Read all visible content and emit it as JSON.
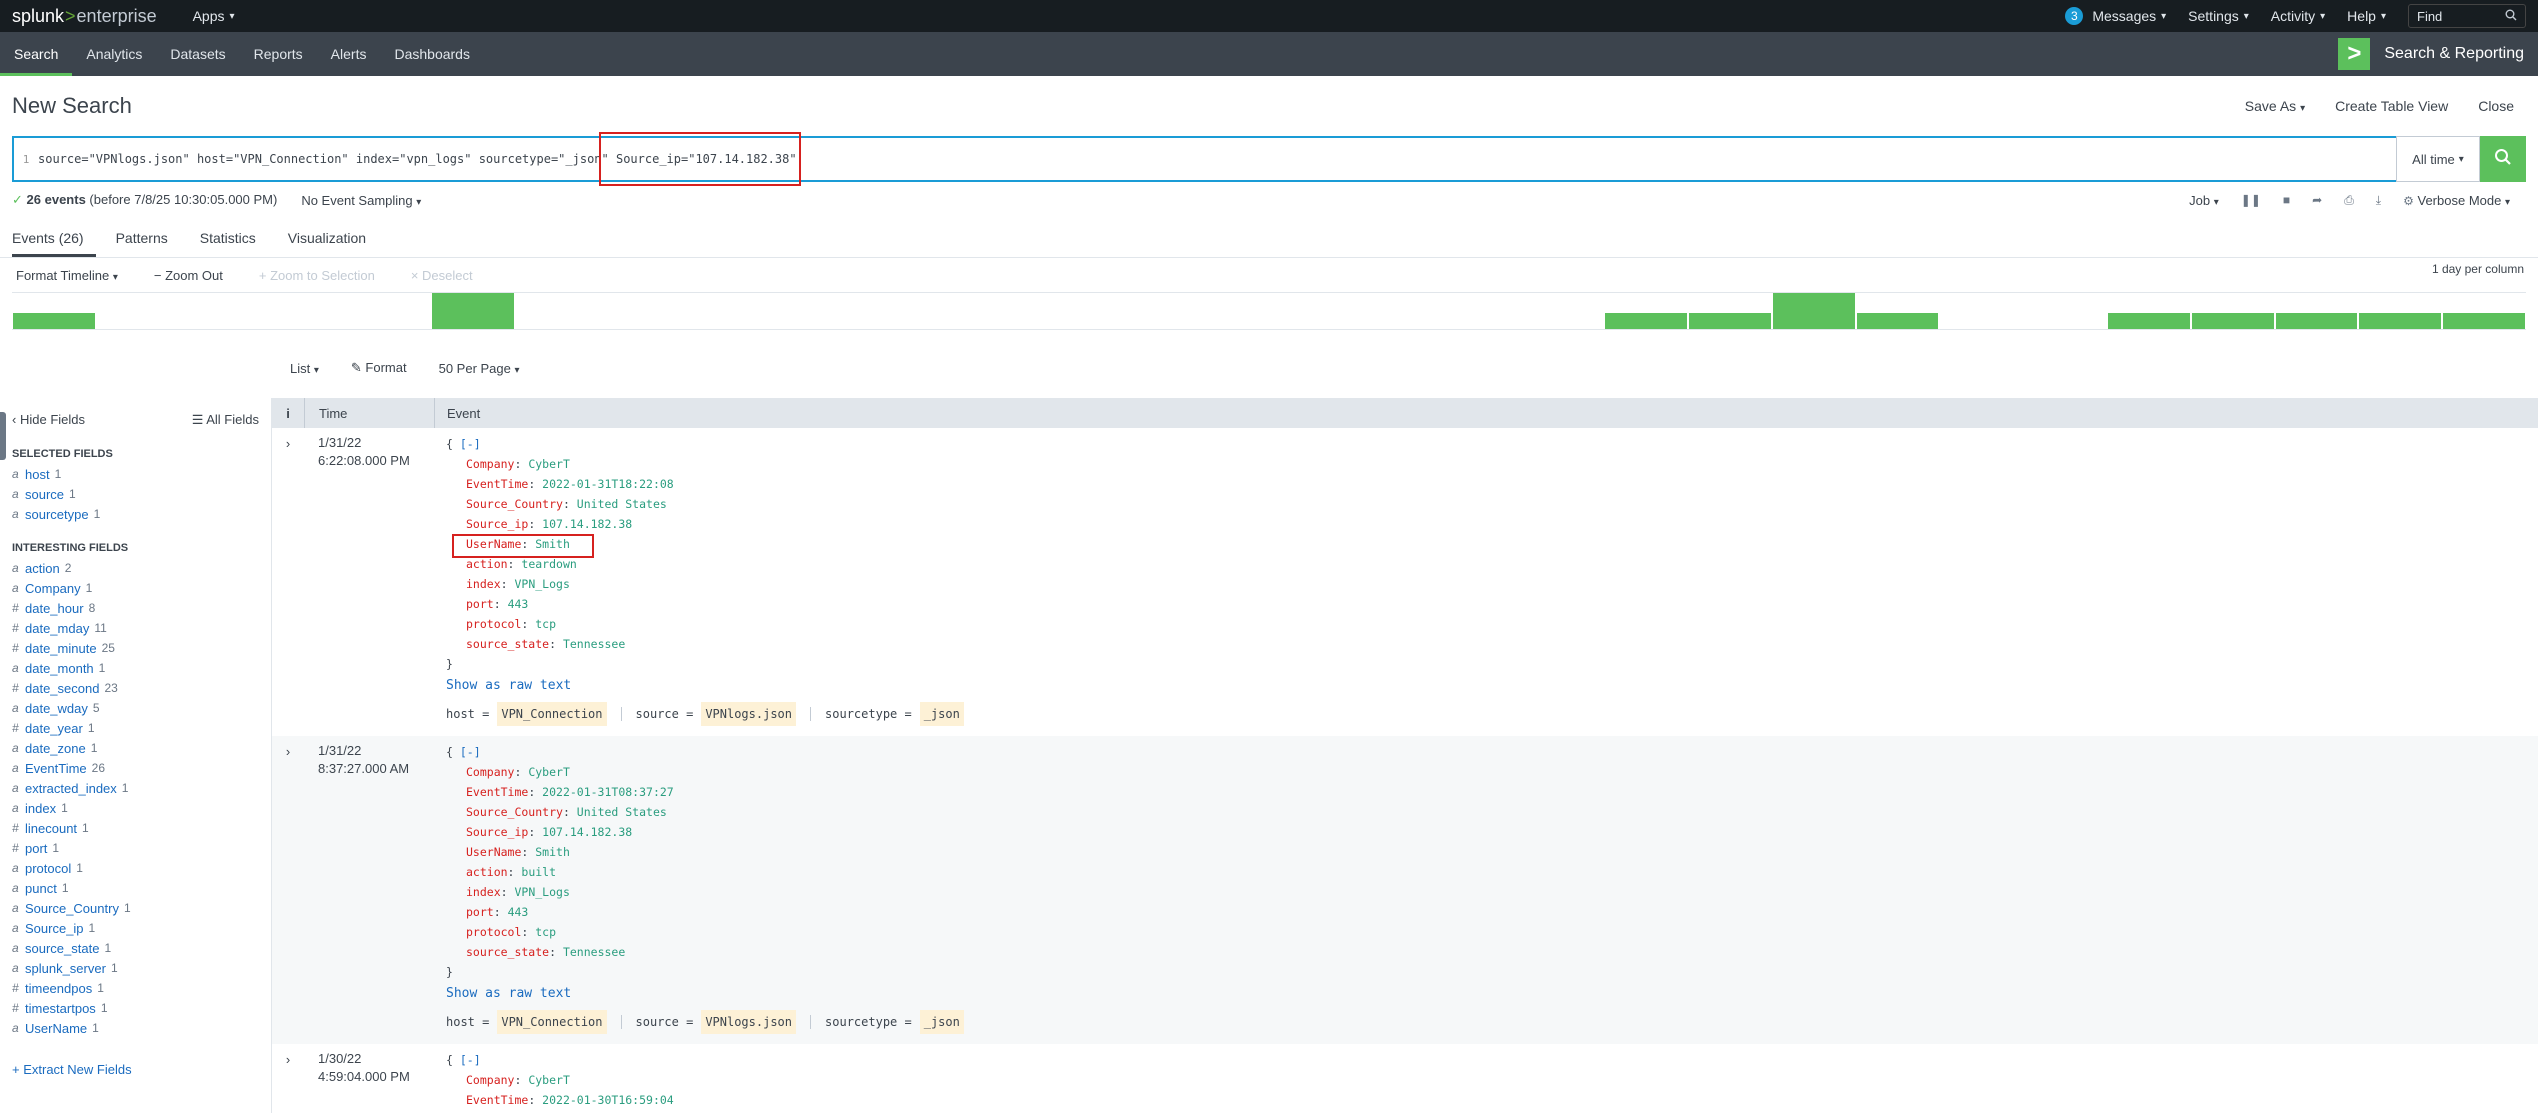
{
  "topbar": {
    "logo_main": "splunk",
    "logo_sep": ">",
    "logo_sub": "enterprise",
    "apps": "Apps",
    "messages_count": "3",
    "messages": "Messages",
    "settings": "Settings",
    "activity": "Activity",
    "help": "Help",
    "find": "Find"
  },
  "appbar": {
    "tabs": [
      "Search",
      "Analytics",
      "Datasets",
      "Reports",
      "Alerts",
      "Dashboards"
    ],
    "app_title": "Search & Reporting"
  },
  "page": {
    "title": "New Search",
    "save_as": "Save As",
    "create_table_view": "Create Table View",
    "close": "Close"
  },
  "search": {
    "line_number": "1",
    "query_part1": "source=\"VPNlogs.json\" host=\"VPN_Connection\" index=\"vpn_logs\" sourcetype=\"_json\" ",
    "query_part2": "Source_ip=\"107.14.182.38\"",
    "time_range": "All time"
  },
  "status": {
    "check": "✓",
    "events": "26 events",
    "before": "(before 7/8/25 10:30:05.000 PM)",
    "sampling": "No Event Sampling",
    "job": "Job",
    "mode": "Verbose Mode"
  },
  "result_tabs": [
    "Events (26)",
    "Patterns",
    "Statistics",
    "Visualization"
  ],
  "timeline": {
    "format": "Format Timeline",
    "zoom_out": "− Zoom Out",
    "zoom_selection": "+ Zoom to Selection",
    "deselect": "× Deselect",
    "per_column": "1 day per column",
    "bars": [
      0.45,
      1,
      0.45,
      0.45,
      1,
      0.45,
      0.45,
      0.45,
      0.45,
      0.45,
      0.45
    ]
  },
  "list_controls": {
    "list": "List",
    "format": "Format",
    "per_page": "50 Per Page"
  },
  "sidebar": {
    "hide_fields": "Hide Fields",
    "all_fields": "All Fields",
    "selected_title": "SELECTED FIELDS",
    "selected": [
      {
        "type": "a",
        "name": "host",
        "count": "1"
      },
      {
        "type": "a",
        "name": "source",
        "count": "1"
      },
      {
        "type": "a",
        "name": "sourcetype",
        "count": "1"
      }
    ],
    "interesting_title": "INTERESTING FIELDS",
    "interesting": [
      {
        "type": "a",
        "name": "action",
        "count": "2"
      },
      {
        "type": "a",
        "name": "Company",
        "count": "1"
      },
      {
        "type": "#",
        "name": "date_hour",
        "count": "8"
      },
      {
        "type": "#",
        "name": "date_mday",
        "count": "11"
      },
      {
        "type": "#",
        "name": "date_minute",
        "count": "25"
      },
      {
        "type": "a",
        "name": "date_month",
        "count": "1"
      },
      {
        "type": "#",
        "name": "date_second",
        "count": "23"
      },
      {
        "type": "a",
        "name": "date_wday",
        "count": "5"
      },
      {
        "type": "#",
        "name": "date_year",
        "count": "1"
      },
      {
        "type": "a",
        "name": "date_zone",
        "count": "1"
      },
      {
        "type": "a",
        "name": "EventTime",
        "count": "26"
      },
      {
        "type": "a",
        "name": "extracted_index",
        "count": "1"
      },
      {
        "type": "a",
        "name": "index",
        "count": "1"
      },
      {
        "type": "#",
        "name": "linecount",
        "count": "1"
      },
      {
        "type": "#",
        "name": "port",
        "count": "1"
      },
      {
        "type": "a",
        "name": "protocol",
        "count": "1"
      },
      {
        "type": "a",
        "name": "punct",
        "count": "1"
      },
      {
        "type": "a",
        "name": "Source_Country",
        "count": "1"
      },
      {
        "type": "a",
        "name": "Source_ip",
        "count": "1"
      },
      {
        "type": "a",
        "name": "source_state",
        "count": "1"
      },
      {
        "type": "a",
        "name": "splunk_server",
        "count": "1"
      },
      {
        "type": "#",
        "name": "timeendpos",
        "count": "1"
      },
      {
        "type": "#",
        "name": "timestartpos",
        "count": "1"
      },
      {
        "type": "a",
        "name": "UserName",
        "count": "1"
      }
    ],
    "extract": "+ Extract New Fields"
  },
  "results_header": {
    "i": "i",
    "time": "Time",
    "event": "Event"
  },
  "events": [
    {
      "date": "1/31/22",
      "time": "6:22:08.000 PM",
      "fields": [
        {
          "k": "Company",
          "v": "CyberT"
        },
        {
          "k": "EventTime",
          "v": "2022-01-31T18:22:08"
        },
        {
          "k": "Source_Country",
          "v": "United States"
        },
        {
          "k": "Source_ip",
          "v": "107.14.182.38"
        },
        {
          "k": "UserName",
          "v": "Smith",
          "hl": true
        },
        {
          "k": "action",
          "v": "teardown"
        },
        {
          "k": "index",
          "v": "VPN_Logs"
        },
        {
          "k": "port",
          "v": "443"
        },
        {
          "k": "protocol",
          "v": "tcp"
        },
        {
          "k": "source_state",
          "v": "Tennessee"
        }
      ],
      "raw": "Show as raw text",
      "host": "VPN_Connection",
      "source": "VPNlogs.json",
      "sourcetype": "_json"
    },
    {
      "date": "1/31/22",
      "time": "8:37:27.000 AM",
      "fields": [
        {
          "k": "Company",
          "v": "CyberT"
        },
        {
          "k": "EventTime",
          "v": "2022-01-31T08:37:27"
        },
        {
          "k": "Source_Country",
          "v": "United States"
        },
        {
          "k": "Source_ip",
          "v": "107.14.182.38"
        },
        {
          "k": "UserName",
          "v": "Smith"
        },
        {
          "k": "action",
          "v": "built"
        },
        {
          "k": "index",
          "v": "VPN_Logs"
        },
        {
          "k": "port",
          "v": "443"
        },
        {
          "k": "protocol",
          "v": "tcp"
        },
        {
          "k": "source_state",
          "v": "Tennessee"
        }
      ],
      "raw": "Show as raw text",
      "host": "VPN_Connection",
      "source": "VPNlogs.json",
      "sourcetype": "_json"
    },
    {
      "date": "1/30/22",
      "time": "4:59:04.000 PM",
      "fields": [
        {
          "k": "Company",
          "v": "CyberT"
        },
        {
          "k": "EventTime",
          "v": "2022-01-30T16:59:04"
        },
        {
          "k": "Source_Country",
          "v": "United States"
        }
      ]
    }
  ],
  "labels": {
    "json_open": "{",
    "json_collapse": "[-]",
    "json_close": "}",
    "host_key": "host =",
    "source_key": "source =",
    "sourcetype_key": "sourcetype =",
    "hide_arrow": "‹",
    "all_fields_icon": "☰",
    "format_icon": "✎",
    "expand": "›"
  }
}
